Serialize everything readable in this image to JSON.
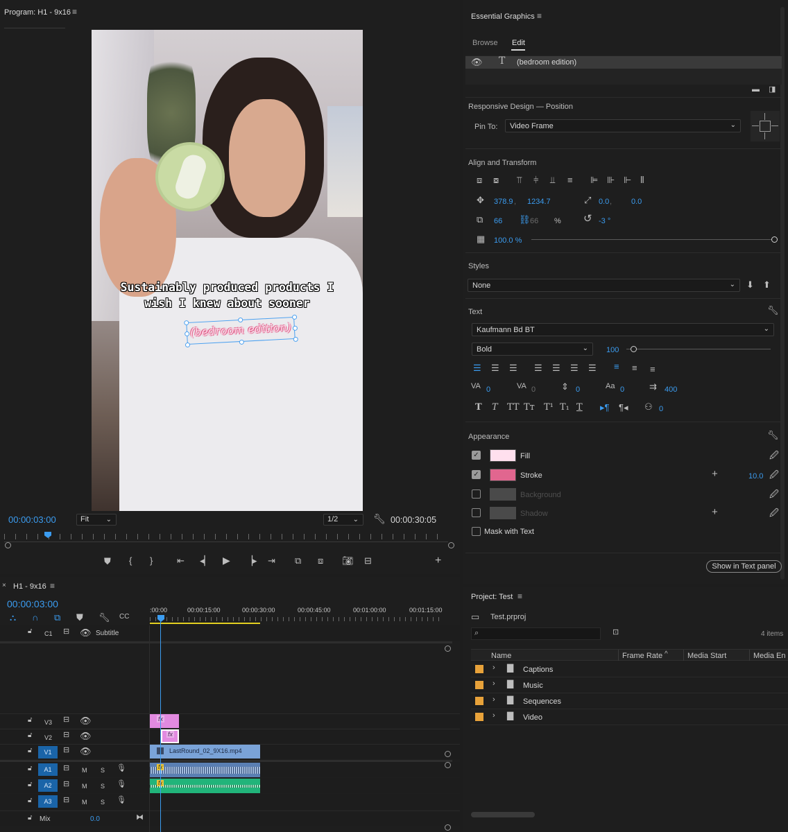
{
  "program": {
    "title": "Program: H1 - 9x16",
    "caption_line1": "Sustainably produced products I",
    "caption_line2": "wish I knew about sooner",
    "overlay_text": "(bedroom edition)",
    "timecode_current": "00:00:03:00",
    "zoom": "Fit",
    "resolution": "1/2",
    "timecode_duration": "00:00:30:05",
    "playhead_fraction": 0.1
  },
  "essential_graphics": {
    "title": "Essential Graphics",
    "tabs": [
      "Browse",
      "Edit"
    ],
    "active_tab": "Edit",
    "layer_name": "(bedroom edition)",
    "responsive_design": {
      "label": "Responsive Design — Position",
      "pin_to_label": "Pin To:",
      "pin_to_value": "Video Frame"
    },
    "align_transform": {
      "label": "Align and Transform",
      "position_x": "378.9",
      "position_y": "1234.7",
      "anchor_x": "0.0",
      "anchor_y": "0.0",
      "scale": "66",
      "scale_linked": "66",
      "scale_unit": "%",
      "rotation": "-3 °",
      "opacity": "100.0 %",
      "opacity_fraction": 1.0
    },
    "styles": {
      "label": "Styles",
      "value": "None"
    },
    "text": {
      "label": "Text",
      "font": "Kaufmann Bd BT",
      "weight": "Bold",
      "size": "100",
      "size_fraction": 0.05,
      "tracking_kerning": "0",
      "kerning": "0",
      "leading": "0",
      "baseline": "0",
      "tab_width": "400",
      "tsume": "0"
    },
    "appearance": {
      "label": "Appearance",
      "items": [
        {
          "label": "Fill",
          "checked": true,
          "color": "#ffe0ee"
        },
        {
          "label": "Stroke",
          "checked": true,
          "color": "#e1668f",
          "value": "10.0"
        },
        {
          "label": "Background",
          "checked": false,
          "color": "#4a4a4a"
        },
        {
          "label": "Shadow",
          "checked": false,
          "color": "#4a4a4a"
        }
      ],
      "mask_label": "Mask with Text"
    },
    "show_text_panel": "Show in Text panel"
  },
  "timeline": {
    "title": "H1 - 9x16",
    "timecode": "00:00:03:00",
    "ruler": [
      ":00:00",
      "00:00:15:00",
      "00:00:30:00",
      "00:00:45:00",
      "00:01:00:00",
      "00:01:15:00"
    ],
    "subtitle_track": {
      "tag": "C1",
      "label": "Subtitle"
    },
    "video_tracks": [
      "V3",
      "V2",
      "V1"
    ],
    "audio_tracks": [
      "A1",
      "A2",
      "A3"
    ],
    "clip_name": "LastRound_02_9X16.mp4",
    "fx_label": "fx",
    "mute": "M",
    "solo": "S",
    "mix_label": "Mix",
    "mix_value": "0.0"
  },
  "project": {
    "title": "Project: Test",
    "file": "Test.prproj",
    "count": "4 items",
    "columns": [
      "Name",
      "Frame Rate",
      "Media Start",
      "Media En"
    ],
    "items": [
      "Captions",
      "Music",
      "Sequences",
      "Video"
    ],
    "item_color": "#e8a23a"
  }
}
